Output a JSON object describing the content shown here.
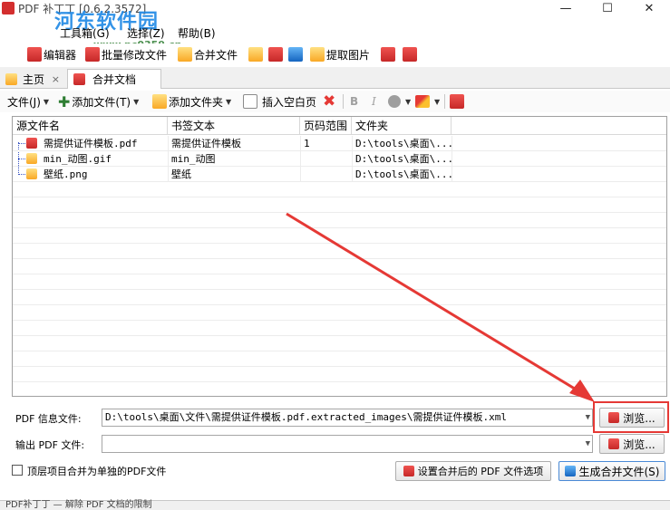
{
  "window": {
    "title": "PDF 补丁丁 [0.6.2.3572]",
    "minimize": "—",
    "maximize": "☐",
    "close": "✕"
  },
  "watermark": {
    "logo": "河东软件园",
    "url": "www.pc0359.cn"
  },
  "menubar": {
    "items": [
      "工具箱(G)",
      "选择(Z)",
      "帮助(B)"
    ]
  },
  "toolbar1": {
    "editor": "编辑器",
    "batch_modify": "批量修改文件",
    "merge_files": "合并文件",
    "extract_images": "提取图片"
  },
  "tabs": {
    "home": "主页",
    "merge": "合并文档",
    "close": "×"
  },
  "toolbar2": {
    "file_menu": "文件(J)",
    "add_file": "添加文件(T)",
    "add_folder": "添加文件夹",
    "insert_blank": "插入空白页",
    "bold": "B",
    "italic": "I"
  },
  "grid": {
    "headers": [
      "源文件名",
      "书签文本",
      "页码范围",
      "文件夹"
    ],
    "rows": [
      {
        "name": "需提供证件模板.pdf",
        "bookmark": "需提供证件模板",
        "pages": "1",
        "folder": "D:\\tools\\桌面\\..."
      },
      {
        "name": "min_动图.gif",
        "bookmark": "min_动图",
        "pages": "",
        "folder": "D:\\tools\\桌面\\..."
      },
      {
        "name": "壁纸.png",
        "bookmark": "壁纸",
        "pages": "",
        "folder": "D:\\tools\\桌面\\..."
      }
    ]
  },
  "form": {
    "pdf_info_label": "PDF 信息文件:",
    "pdf_info_value": "D:\\tools\\桌面\\文件\\需提供证件模板.pdf.extracted_images\\需提供证件模板.xml",
    "browse": "浏览...",
    "output_label": "输出 PDF 文件:",
    "output_value": "",
    "top_level_checkbox": "顶层项目合并为单独的PDF文件",
    "settings_button": "设置合并后的 PDF 文件选项",
    "generate_button": "生成合并文件(S)"
  },
  "statusbar": {
    "text": "PDF补丁丁 — 解除 PDF 文档的限制"
  },
  "colors": {
    "highlight": "#e53935",
    "arrow": "#e53935"
  }
}
